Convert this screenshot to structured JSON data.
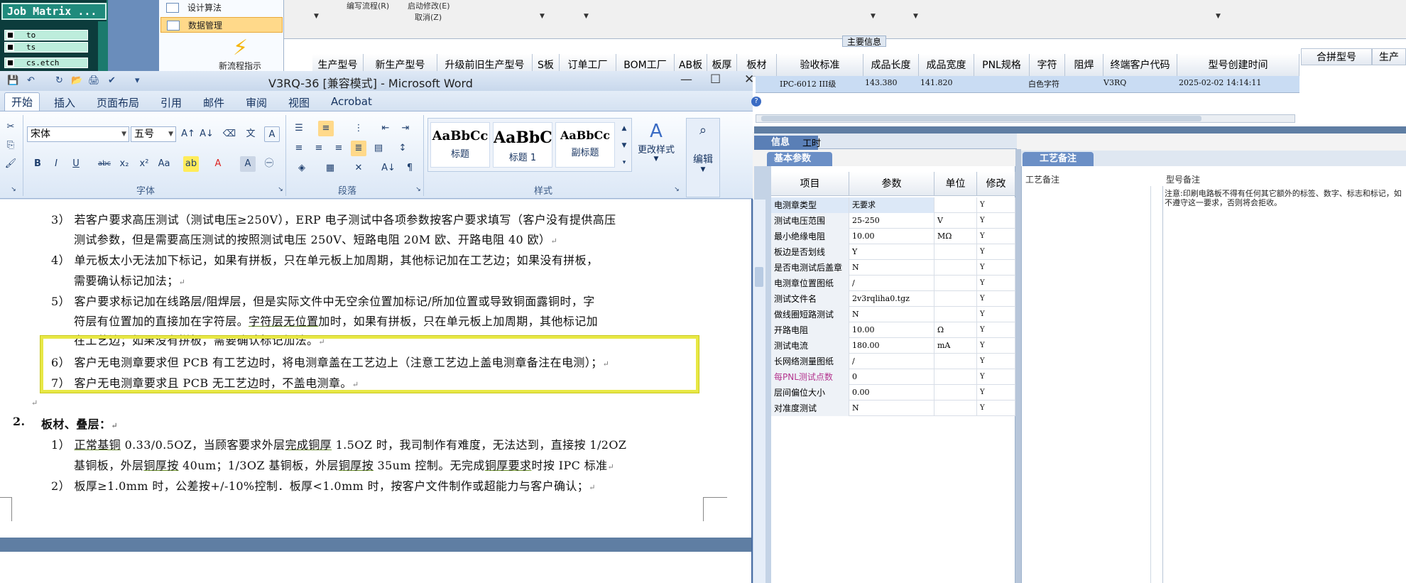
{
  "erp": {
    "job_matrix": {
      "title": "Job Matrix ...",
      "rows": [
        "to",
        "ts",
        "cs.etch"
      ]
    },
    "nav_menu": {
      "items": [
        {
          "label": "设计算法"
        },
        {
          "label": "数据管理"
        }
      ],
      "new_flow_label": "新流程指示"
    },
    "top_menus": {
      "edit_flow": "编写流程(R)",
      "start_modify": "启动修改(E)",
      "cancel": "取消(Z)"
    },
    "grid": {
      "group_title": "主要信息",
      "headers": [
        "生产型号",
        "新生产型号",
        "升级前旧生产型号",
        "S板",
        "订单工厂",
        "BOM工厂",
        "AB板",
        "板厚",
        "板材",
        "验收标准",
        "成品长度",
        "成品宽度",
        "PNL规格",
        "字符",
        "阻焊",
        "终端客户代码",
        "型号创建时间"
      ],
      "merge_header": "合拼型号",
      "extra_header": "生产",
      "row": {
        "acceptance": "IPC-6012 III级",
        "length": "143.380",
        "width": "141.820",
        "char": "白色字符",
        "customer": "V3RQ",
        "created": "2025-02-02 14:14:11"
      }
    },
    "lower_tabs": [
      "信息",
      "工时"
    ],
    "basic_params": {
      "title": "基本参数",
      "headers": [
        "项目",
        "参数",
        "单位",
        "修改"
      ],
      "rows": [
        {
          "name": "电测章类型",
          "value": "无要求",
          "unit": "",
          "mod": "Y"
        },
        {
          "name": "测试电压范围",
          "value": "25-250",
          "unit": "V",
          "mod": "Y"
        },
        {
          "name": "最小绝缘电阻",
          "value": "10.00",
          "unit": "MΩ",
          "mod": "Y"
        },
        {
          "name": "板边是否划线",
          "value": "Y",
          "unit": "",
          "mod": "Y"
        },
        {
          "name": "是否电测试后盖章",
          "value": "N",
          "unit": "",
          "mod": "Y"
        },
        {
          "name": "电测章位置图纸",
          "value": "/",
          "unit": "",
          "mod": "Y"
        },
        {
          "name": "测试文件名",
          "value": "2v3rqliha0.tgz",
          "unit": "",
          "mod": "Y"
        },
        {
          "name": "做线圈短路测试",
          "value": "N",
          "unit": "",
          "mod": "Y"
        },
        {
          "name": "开路电阻",
          "value": "10.00",
          "unit": "Ω",
          "mod": "Y"
        },
        {
          "name": "测试电流",
          "value": "180.00",
          "unit": "mA",
          "mod": "Y"
        },
        {
          "name": "长网络测量图纸",
          "value": "/",
          "unit": "",
          "mod": "Y"
        },
        {
          "name": "每PNL测试点数",
          "value": "0",
          "unit": "",
          "mod": "Y"
        },
        {
          "name": "层间偏位大小",
          "value": "0.00",
          "unit": "",
          "mod": "Y"
        },
        {
          "name": "对准度测试",
          "value": "N",
          "unit": "",
          "mod": "Y"
        }
      ]
    },
    "remarks": {
      "tab": "工艺备注",
      "col1": "工艺备注",
      "col2": "型号备注",
      "text": "注意:印刷电路板不得有任何其它额外的标签、数字、标志和标记，如不遵守这一要求，否则将会拒收。"
    }
  },
  "word": {
    "title": "V3RQ-36 [兼容模式] - Microsoft Word",
    "tabs": [
      "开始",
      "插入",
      "页面布局",
      "引用",
      "邮件",
      "审阅",
      "视图",
      "Acrobat"
    ],
    "font": {
      "name": "宋体",
      "size": "五号"
    },
    "groups": {
      "font": "字体",
      "paragraph": "段落",
      "styles": "样式",
      "edit": "编辑"
    },
    "styles": [
      {
        "preview": "AaBbCc",
        "name": "标题"
      },
      {
        "preview": "AaBbC",
        "name": "标题 1"
      },
      {
        "preview": "AaBbCc",
        "name": "副标题"
      }
    ],
    "change_style": "更改样式",
    "doc": {
      "lines": [
        "3） 若客户要求高压测试（测试电压≥250V），ERP 电子测试中各项参数按客户要求填写（客户没有提供高压",
        "测试参数，但是需要高压测试的按照测试电压 250V、短路电阻 20M 欧、开路电阻 40 欧）",
        "4） 单元板太小无法加下标记，如果有拼板，只在单元板上加周期，其他标记加在工艺边；如果没有拼板，",
        "需要确认标记加法；",
        "5） 客户要求标记加在线路层/阻焊层，但是实际文件中无空余位置加标记/所加位置或导致铜面露铜时，字",
        "符层有位置加的直接加在字符层。",
        "字符层无位置",
        "加时，如果有拼板，只在单元板上加周期，其他标记加",
        "在工艺边；如果没有拼板，需要确认标记加法。",
        "6） 客户无电测章要求但 PCB 有工艺边时，将电测章盖在工艺边上（注意工艺边上盖电测章备注在电测）；",
        "7） 客户无电测章要求且 PCB 无工艺边时，不盖电测章。",
        "2.",
        "板材、叠层：",
        "1） ",
        "正常基铜",
        " 0.33/0.5OZ，当顾客要求外层",
        "完成铜厚",
        " 1.5OZ 时，我司制作有难度，无法达到，直接按 1/2OZ",
        "基铜板，外层",
        "铜厚按",
        " 40um；1/3OZ 基铜板，外层",
        "铜厚按",
        " 35um 控制。无完成",
        "铜厚要求",
        "时按 IPC 标准",
        "2） 板厚≥1.0mm 时，公差按+/-10%控制．板厚<1.0mm 时，按客户文件制作或超能力与客户确认；"
      ],
      "para_mark": "↵"
    }
  },
  "colors": {
    "highlight_box": "#e8e845",
    "word_chrome": "#d7e3f2",
    "erp_accent": "#5a7fb6"
  }
}
